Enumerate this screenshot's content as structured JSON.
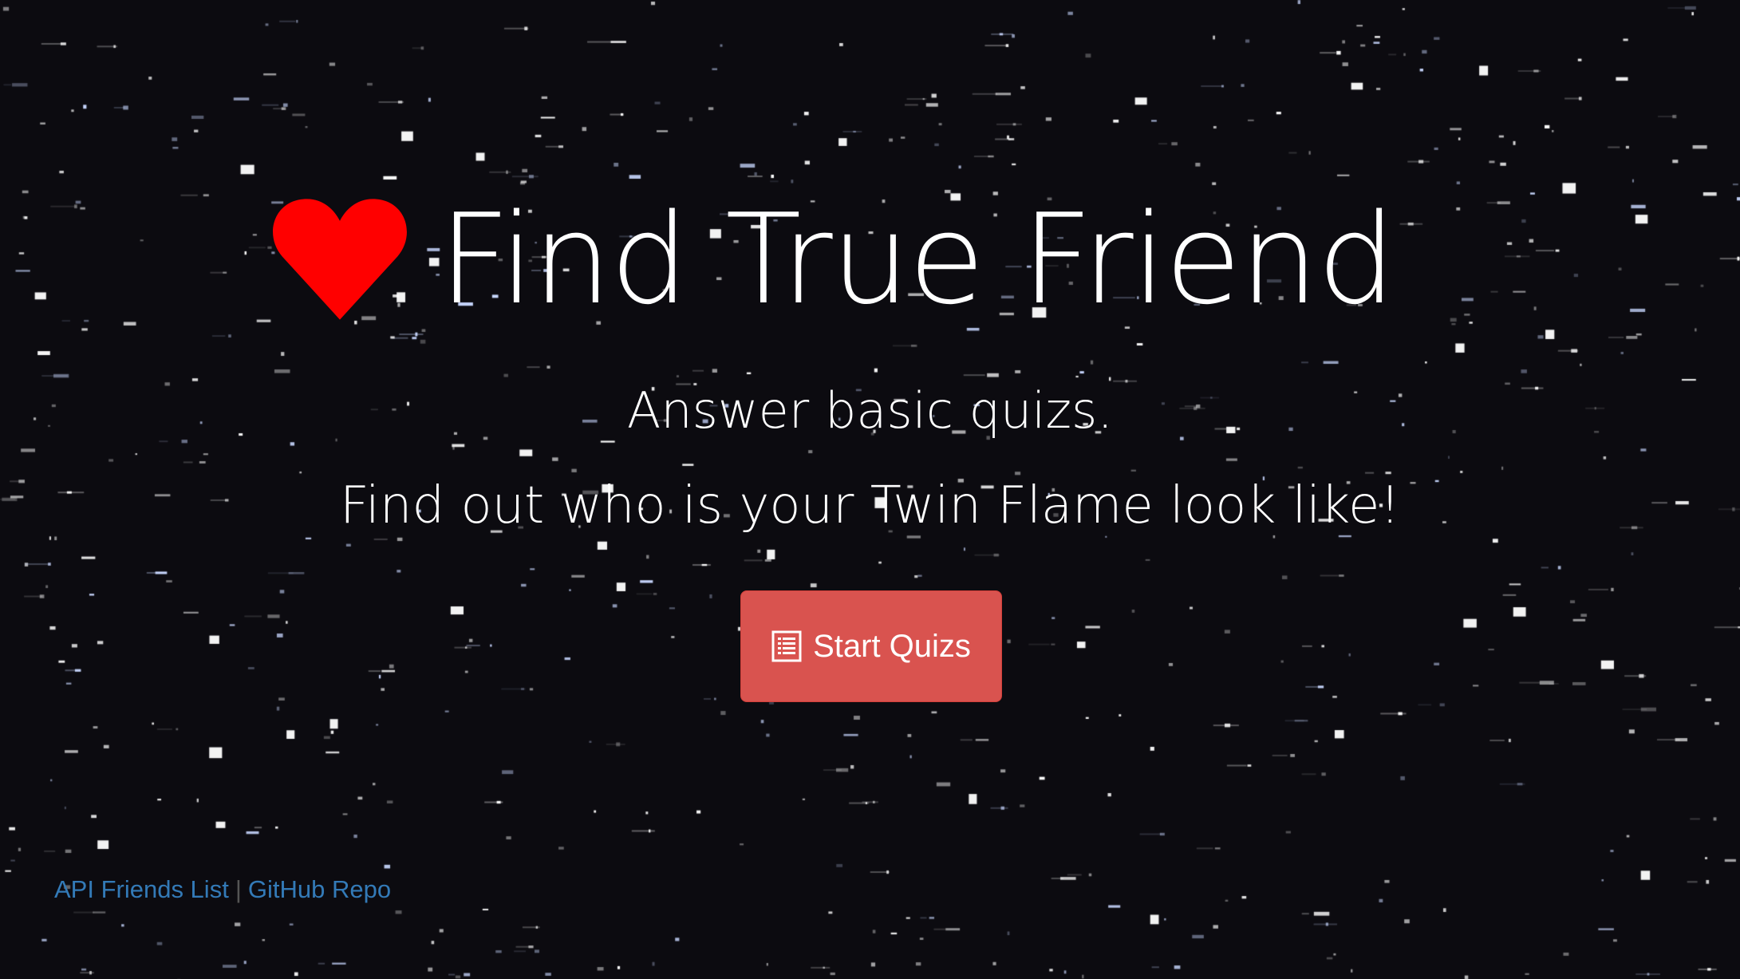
{
  "hero": {
    "icon": "heart-icon",
    "icon_color": "#ff0000",
    "title": "Find True Friend",
    "subtitle_1": "Answer basic quizs.",
    "subtitle_2": "Find out who is your Twin Flame look like!"
  },
  "cta": {
    "icon": "list-icon",
    "label": "Start Quizs",
    "color": "#d9534f"
  },
  "footer": {
    "links": [
      "API Friends List",
      "GitHub Repo"
    ],
    "separator": "|",
    "link_color": "#337ab7"
  },
  "background": {
    "color": "#0c0b10",
    "star_color": "#ffffff"
  }
}
